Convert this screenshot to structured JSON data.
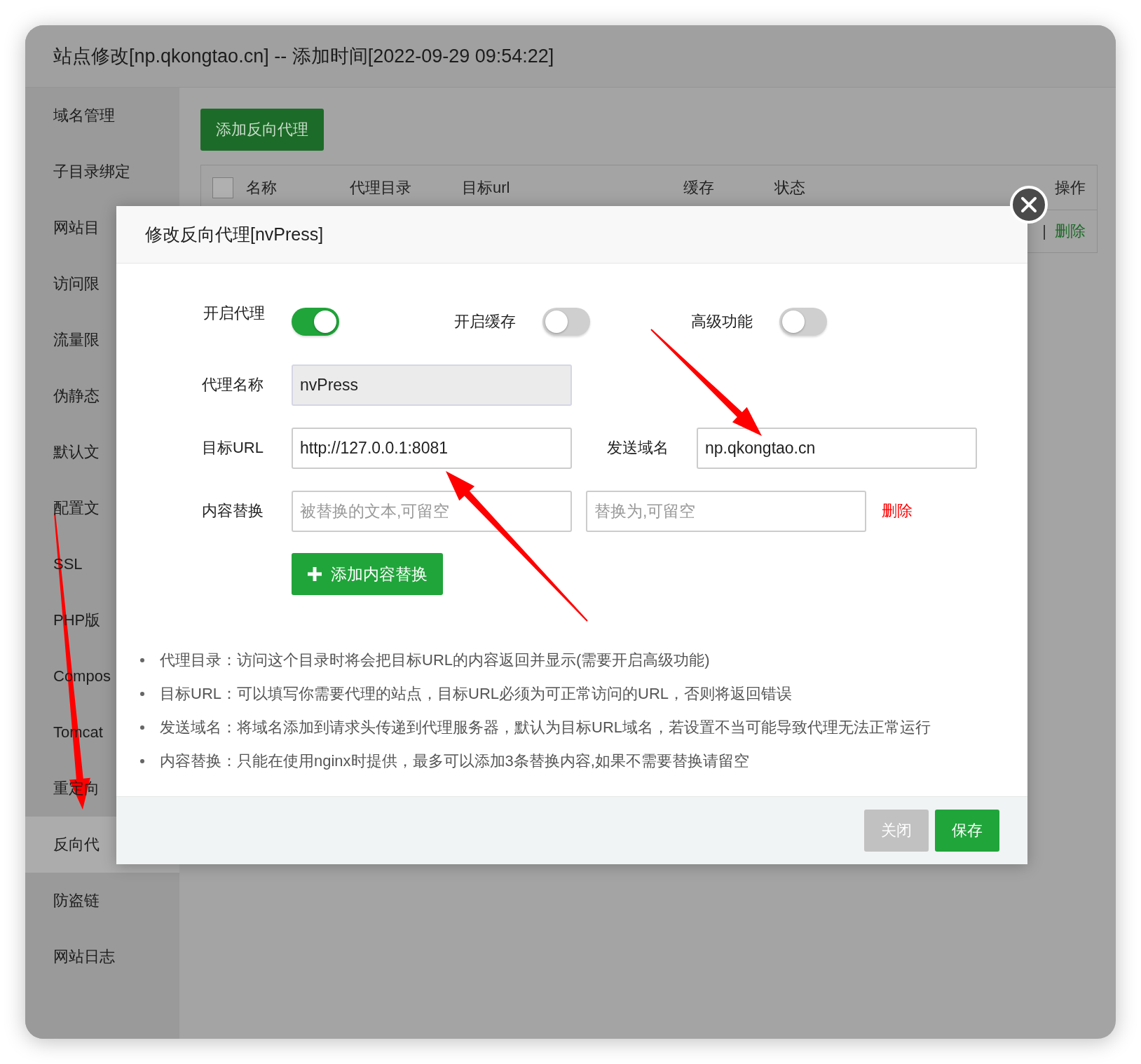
{
  "window": {
    "title": "站点修改[np.qkongtao.cn] -- 添加时间[2022-09-29 09:54:22]"
  },
  "sidebar": {
    "items": [
      {
        "label": "域名管理",
        "selected": false
      },
      {
        "label": "子目录绑定",
        "selected": false
      },
      {
        "label": "网站目",
        "selected": false
      },
      {
        "label": "访问限",
        "selected": false
      },
      {
        "label": "流量限",
        "selected": false
      },
      {
        "label": "伪静态",
        "selected": false
      },
      {
        "label": "默认文",
        "selected": false
      },
      {
        "label": "配置文",
        "selected": false
      },
      {
        "label": "SSL",
        "selected": false
      },
      {
        "label": "PHP版",
        "selected": false
      },
      {
        "label": "Compos",
        "selected": false
      },
      {
        "label": "Tomcat",
        "selected": false
      },
      {
        "label": "重定向",
        "selected": false
      },
      {
        "label": "反向代",
        "selected": true
      },
      {
        "label": "防盗链",
        "selected": false
      },
      {
        "label": "网站日志",
        "selected": false
      }
    ]
  },
  "toolbar": {
    "add_button": "添加反向代理"
  },
  "table": {
    "select_all": {
      "checked": false
    },
    "columns": [
      "名称",
      "代理目录",
      "目标url",
      "缓存",
      "状态",
      "操作"
    ],
    "rows": [
      {
        "separator": "|",
        "action": "删除"
      }
    ]
  },
  "dialog": {
    "title": "修改反向代理[nvPress]",
    "switches": [
      {
        "label": "开启代理",
        "on": true
      },
      {
        "label": "开启缓存",
        "on": false
      },
      {
        "label": "高级功能",
        "on": false
      }
    ],
    "name_field": {
      "label": "代理名称",
      "value": "nvPress",
      "disabled": true
    },
    "url_fields": [
      {
        "label": "目标URL",
        "value": "http://127.0.0.1:8081"
      },
      {
        "label": "发送域名",
        "value": "np.qkongtao.cn"
      }
    ],
    "replace_row": {
      "label": "内容替换",
      "placeholders": [
        "被替换的文本,可留空",
        "替换为,可留空"
      ],
      "delete": "删除"
    },
    "add_button": "添加内容替换",
    "notes": [
      "代理目录：访问这个目录时将会把目标URL的内容返回并显示(需要开启高级功能)",
      "目标URL：可以填写你需要代理的站点，目标URL必须为可正常访问的URL，否则将返回错误",
      "发送域名：将域名添加到请求头传递到代理服务器，默认为目标URL域名，若设置不当可能导致代理无法正常运行",
      "内容替换：只能在使用nginx时提供，最多可以添加3条替换内容,如果不需要替换请留空"
    ],
    "buttons": [
      {
        "label": "关闭",
        "kind": "secondary"
      },
      {
        "label": "保存",
        "kind": "primary"
      }
    ]
  }
}
